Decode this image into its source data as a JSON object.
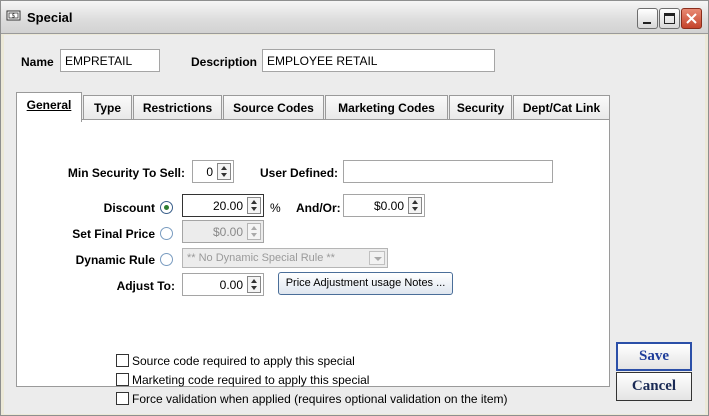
{
  "window": {
    "title": "Special",
    "icon": "money-icon"
  },
  "header": {
    "name_label": "Name",
    "name_value": "EMPRETAIL",
    "description_label": "Description",
    "description_value": "EMPLOYEE RETAIL"
  },
  "tabs": [
    {
      "label": "General",
      "active": true
    },
    {
      "label": "Type"
    },
    {
      "label": "Restrictions"
    },
    {
      "label": "Source Codes"
    },
    {
      "label": "Marketing Codes"
    },
    {
      "label": "Security"
    },
    {
      "label": "Dept/Cat Link"
    }
  ],
  "general": {
    "min_security_label": "Min Security To Sell:",
    "min_security_value": "0",
    "user_defined_label": "User Defined:",
    "user_defined_value": "",
    "discount_label": "Discount",
    "discount_value": "20.00",
    "percent_label": "%",
    "andor_label": "And/Or:",
    "andor_value": "$0.00",
    "final_price_label": "Set Final Price",
    "final_price_value": "$0.00",
    "dynamic_rule_label": "Dynamic Rule",
    "dynamic_rule_value": "** No Dynamic Special Rule **",
    "adjust_to_label": "Adjust To:",
    "adjust_to_value": "0.00",
    "price_notes_button": "Price Adjustment usage Notes ...",
    "checkboxes": [
      {
        "label": "Source code required to apply this special",
        "checked": false
      },
      {
        "label": "Marketing code required to apply this special",
        "checked": false
      },
      {
        "label": "Force validation when applied (requires optional validation on the item)",
        "checked": false
      }
    ]
  },
  "actions": {
    "save_label": "Save",
    "cancel_label": "Cancel"
  },
  "colors": {
    "selected_radio": "#2e7d32",
    "save_text": "#1f3d9a"
  }
}
